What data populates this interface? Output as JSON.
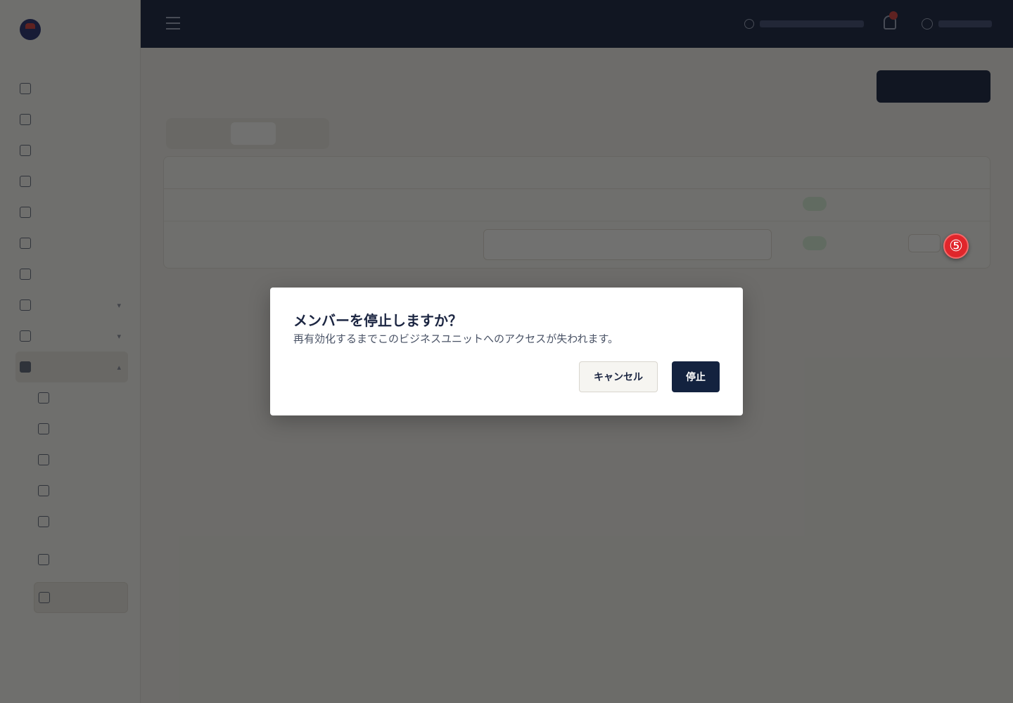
{
  "dialog": {
    "title": "メンバーを停止しますか？",
    "description": "再有効化するまでこのビジネスユニットへのアクセスが失われます。",
    "cancel_label": "キャンセル",
    "confirm_label": "停止"
  },
  "step_marker": "⑤",
  "colors": {
    "primary": "#13223f",
    "topbar": "#0f1c3d",
    "step_marker": "#e0262b",
    "active_badge": "#2f7d3a"
  }
}
